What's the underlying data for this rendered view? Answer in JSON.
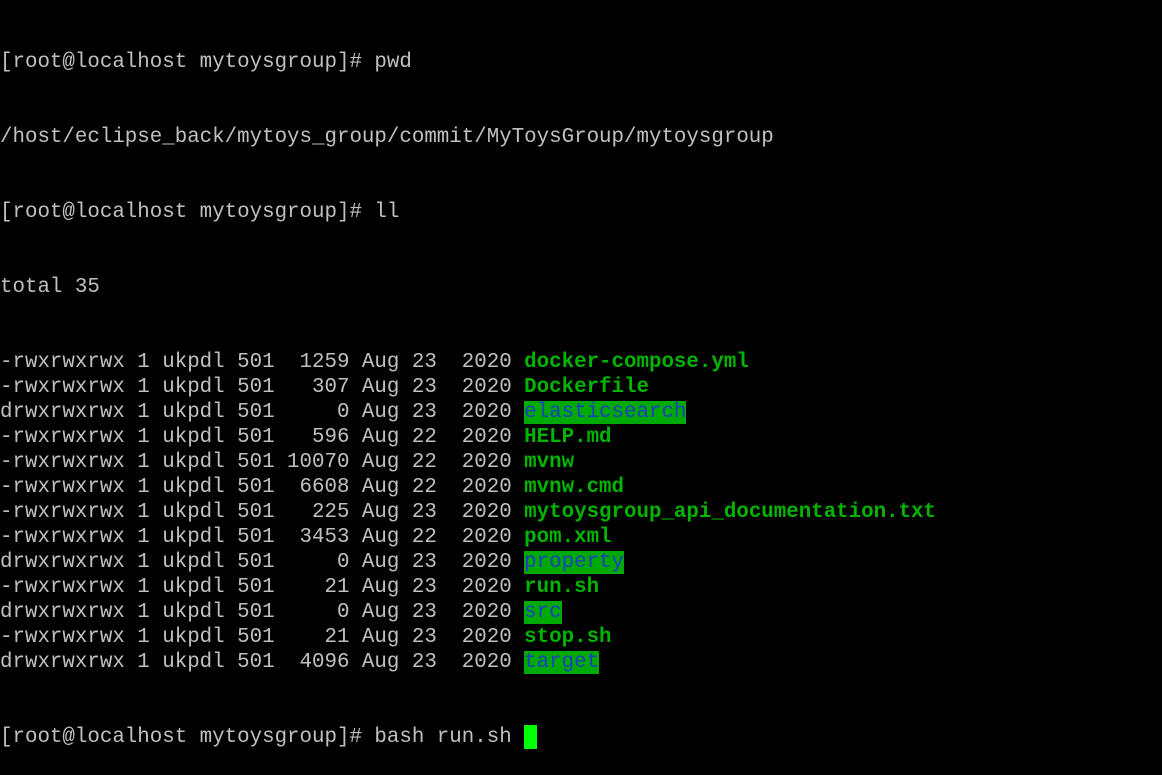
{
  "colors": {
    "background": "#000000",
    "text": "#c0c0c0",
    "file_green": "#00b400",
    "dir_bg": "#00aa00",
    "dir_fg": "#1a3fc2",
    "cursor": "#00ff00"
  },
  "prompt": "[root@localhost mytoysgroup]# ",
  "commands": {
    "pwd": "pwd",
    "pwd_output": "/host/eclipse_back/mytoys_group/commit/MyToysGroup/mytoysgroup",
    "ll": "ll",
    "total": "total 35",
    "current_input": "bash run.sh "
  },
  "listing": [
    {
      "meta": "-rwxrwxrwx 1 ukpdl 501  1259 Aug 23  2020 ",
      "name": "docker-compose.yml",
      "type": "file"
    },
    {
      "meta": "-rwxrwxrwx 1 ukpdl 501   307 Aug 23  2020 ",
      "name": "Dockerfile",
      "type": "file"
    },
    {
      "meta": "drwxrwxrwx 1 ukpdl 501     0 Aug 23  2020 ",
      "name": "elasticsearch",
      "type": "dir"
    },
    {
      "meta": "-rwxrwxrwx 1 ukpdl 501   596 Aug 22  2020 ",
      "name": "HELP.md",
      "type": "file"
    },
    {
      "meta": "-rwxrwxrwx 1 ukpdl 501 10070 Aug 22  2020 ",
      "name": "mvnw",
      "type": "file"
    },
    {
      "meta": "-rwxrwxrwx 1 ukpdl 501  6608 Aug 22  2020 ",
      "name": "mvnw.cmd",
      "type": "file"
    },
    {
      "meta": "-rwxrwxrwx 1 ukpdl 501   225 Aug 23  2020 ",
      "name": "mytoysgroup_api_documentation.txt",
      "type": "file"
    },
    {
      "meta": "-rwxrwxrwx 1 ukpdl 501  3453 Aug 22  2020 ",
      "name": "pom.xml",
      "type": "file"
    },
    {
      "meta": "drwxrwxrwx 1 ukpdl 501     0 Aug 23  2020 ",
      "name": "property",
      "type": "dir"
    },
    {
      "meta": "-rwxrwxrwx 1 ukpdl 501    21 Aug 23  2020 ",
      "name": "run.sh",
      "type": "file"
    },
    {
      "meta": "drwxrwxrwx 1 ukpdl 501     0 Aug 23  2020 ",
      "name": "src",
      "type": "dir"
    },
    {
      "meta": "-rwxrwxrwx 1 ukpdl 501    21 Aug 23  2020 ",
      "name": "stop.sh",
      "type": "file"
    },
    {
      "meta": "drwxrwxrwx 1 ukpdl 501  4096 Aug 23  2020 ",
      "name": "target",
      "type": "dir"
    }
  ]
}
